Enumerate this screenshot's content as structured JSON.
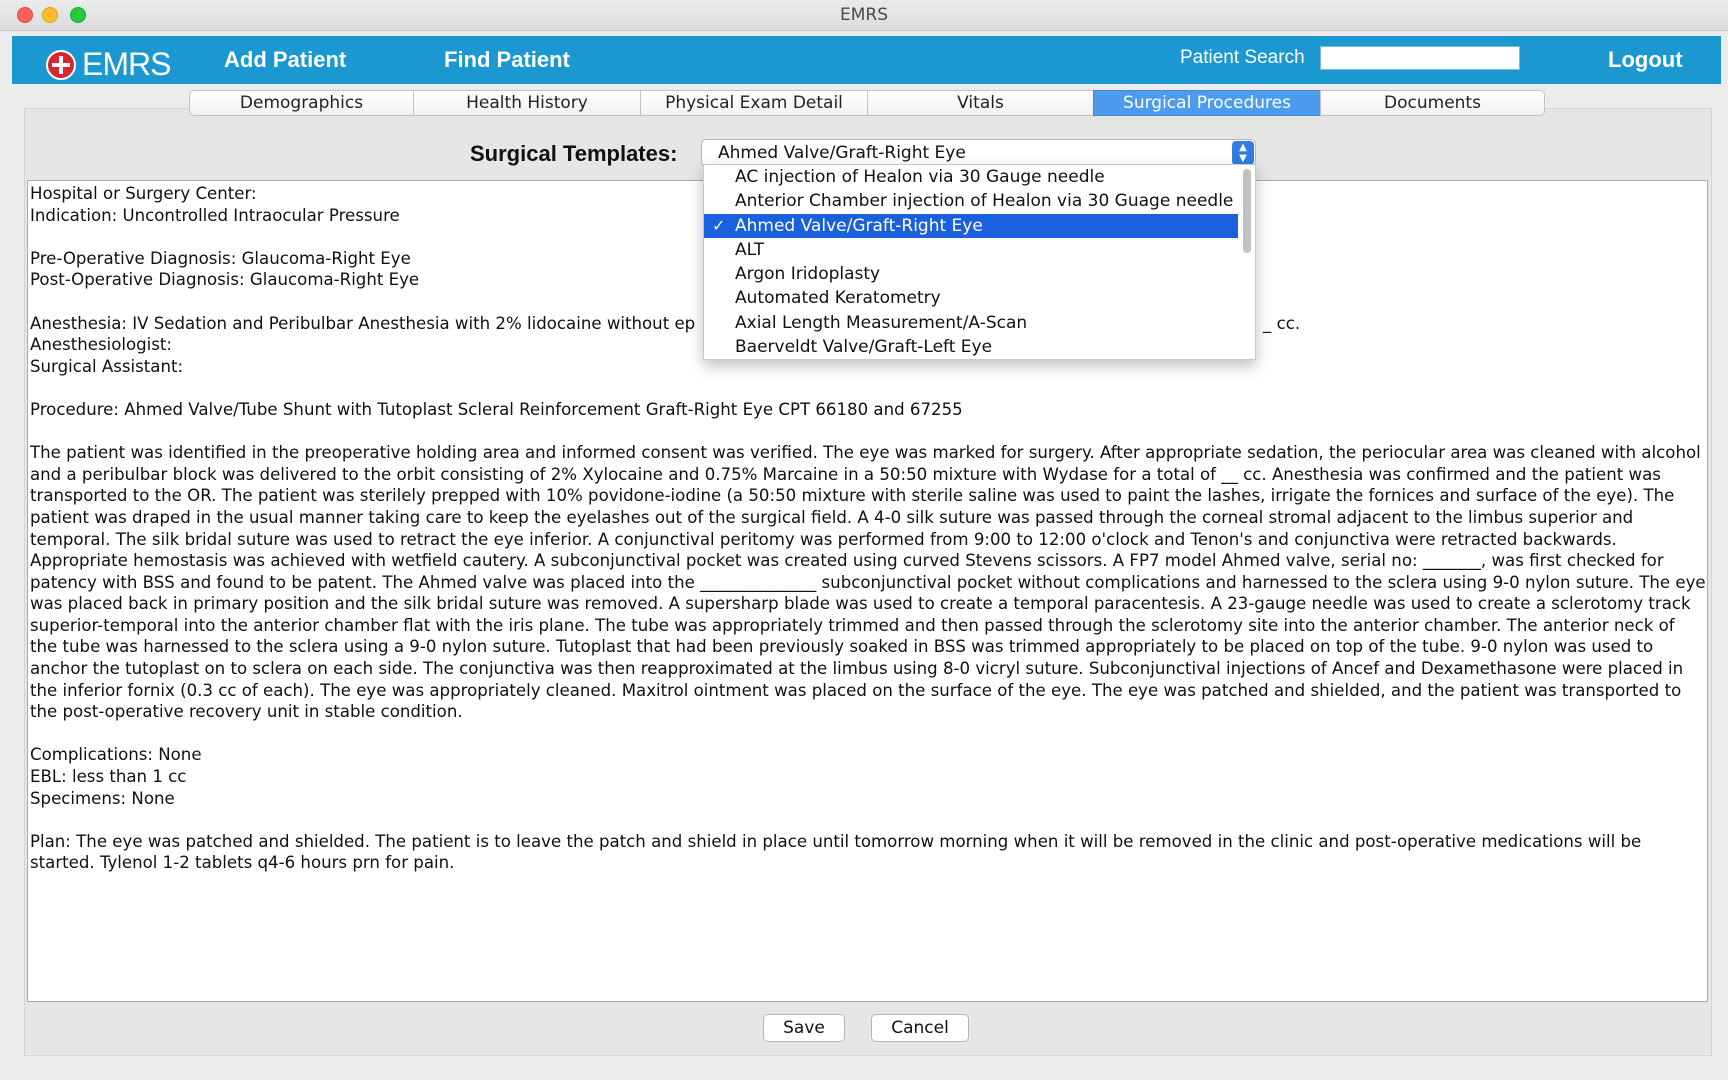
{
  "window": {
    "title": "EMRS"
  },
  "header": {
    "logo_text": "EMRS",
    "nav": [
      "Add Patient",
      "Find Patient"
    ],
    "search_label": "Patient Search",
    "search_value": "",
    "logout_label": "Logout"
  },
  "tabs": [
    {
      "label": "Demographics",
      "active": false
    },
    {
      "label": "Health History",
      "active": false
    },
    {
      "label": "Physical Exam Detail",
      "active": false
    },
    {
      "label": "Vitals",
      "active": false
    },
    {
      "label": "Surgical Procedures",
      "active": true
    },
    {
      "label": "Documents",
      "active": false
    }
  ],
  "templates": {
    "label": "Surgical Templates:",
    "selected": "Ahmed Valve/Graft-Right Eye",
    "options": [
      "AC injection of Healon via 30 Gauge needle",
      "Anterior Chamber injection of Healon via 30 Guage needle",
      "Ahmed Valve/Graft-Right Eye",
      "ALT",
      "Argon Iridoplasty",
      "Automated Keratometry",
      "Axial Length Measurement/A-Scan",
      "Baerveldt Valve/Graft-Left Eye"
    ],
    "selected_index": 2
  },
  "note": {
    "hospital": "Hospital or Surgery Center:",
    "indication": "Indication: Uncontrolled Intraocular Pressure",
    "preop": "Pre-Operative Diagnosis: Glaucoma-Right Eye",
    "postop": "Post-Operative Diagnosis: Glaucoma-Right Eye",
    "anesthesia": "Anesthesia: IV Sedation and Peribulbar Anesthesia with 2% lidocaine without ep",
    "anesthesia_tail": "_ cc.",
    "anesthesiologist": "Anesthesiologist:",
    "assistant": "Surgical Assistant:",
    "procedure": "Procedure: Ahmed Valve/Tube Shunt with Tutoplast Scleral Reinforcement Graft-Right Eye CPT 66180 and 67255",
    "body": "The patient was identified in the preoperative holding area and informed consent was verified. The eye was marked for surgery. After appropriate sedation, the periocular area was cleaned with alcohol and a peribulbar block was delivered to the orbit consisting of 2% Xylocaine and 0.75% Marcaine in a 50:50 mixture with Wydase for a total of __ cc. Anesthesia was confirmed and the patient was transported to the OR. The patient was sterilely prepped with 10% povidone-iodine (a 50:50 mixture with sterile saline was used to paint the lashes, irrigate the fornices and surface of the eye). The patient was draped in the usual manner taking care to keep the eyelashes out of the surgical field. A 4-0 silk suture was passed through the corneal stromal adjacent to the limbus superior and temporal. The silk bridal suture was used to retract the eye inferior.  A conjunctival peritomy was performed from 9:00 to 12:00 o'clock and Tenon's and conjunctiva were retracted backwards. Appropriate hemostasis was achieved with wetfield cautery. A subconjunctival pocket was created using curved Stevens scissors. A FP7 model Ahmed valve, serial no: _______, was first checked for patency with BSS and found to be patent. The Ahmed valve was placed into the ______________ subconjunctival pocket without complications and harnessed to the sclera using 9-0 nylon suture. The eye was placed back in primary position and the silk bridal suture was removed. A supersharp blade was used to create a temporal paracentesis. A 23-gauge needle was used to create a sclerotomy track superior-temporal into the anterior chamber flat with the iris plane. The tube was appropriately trimmed and then passed through the sclerotomy site into the anterior chamber. The anterior neck of the tube was harnessed to the sclera using a 9-0 nylon suture. Tutoplast that had been previously soaked in BSS was trimmed appropriately to be placed on top of the tube. 9-0 nylon was used to anchor the tutoplast on to sclera on each side. The conjunctiva was then reapproximated at the limbus using 8-0 vicryl suture. Subconjunctival injections of Ancef and Dexamethasone were placed in the inferior fornix (0.3 cc of each). The eye was appropriately cleaned. Maxitrol ointment was placed on the surface of the eye. The eye was patched and shielded, and the patient was transported to the post-operative recovery unit in stable condition.",
    "complications": "Complications: None",
    "ebl": "EBL: less than 1 cc",
    "specimens": "Specimens: None",
    "plan": "Plan: The eye was patched and shielded. The patient is to leave the patch and shield in place until tomorrow morning when it will be removed in the clinic and post-operative medications will be started. Tylenol 1-2 tablets q4-6 hours prn for pain."
  },
  "buttons": {
    "save": "Save",
    "cancel": "Cancel"
  },
  "colors": {
    "header": "#1a98cf",
    "active_tab": "#4c9bec",
    "selection": "#1a5fdc",
    "logo_cross": "#d8262f"
  },
  "icons": [
    "close-icon",
    "minimize-icon",
    "maximize-icon",
    "red-cross-icon",
    "checkmark-icon",
    "updown-arrows-icon"
  ]
}
